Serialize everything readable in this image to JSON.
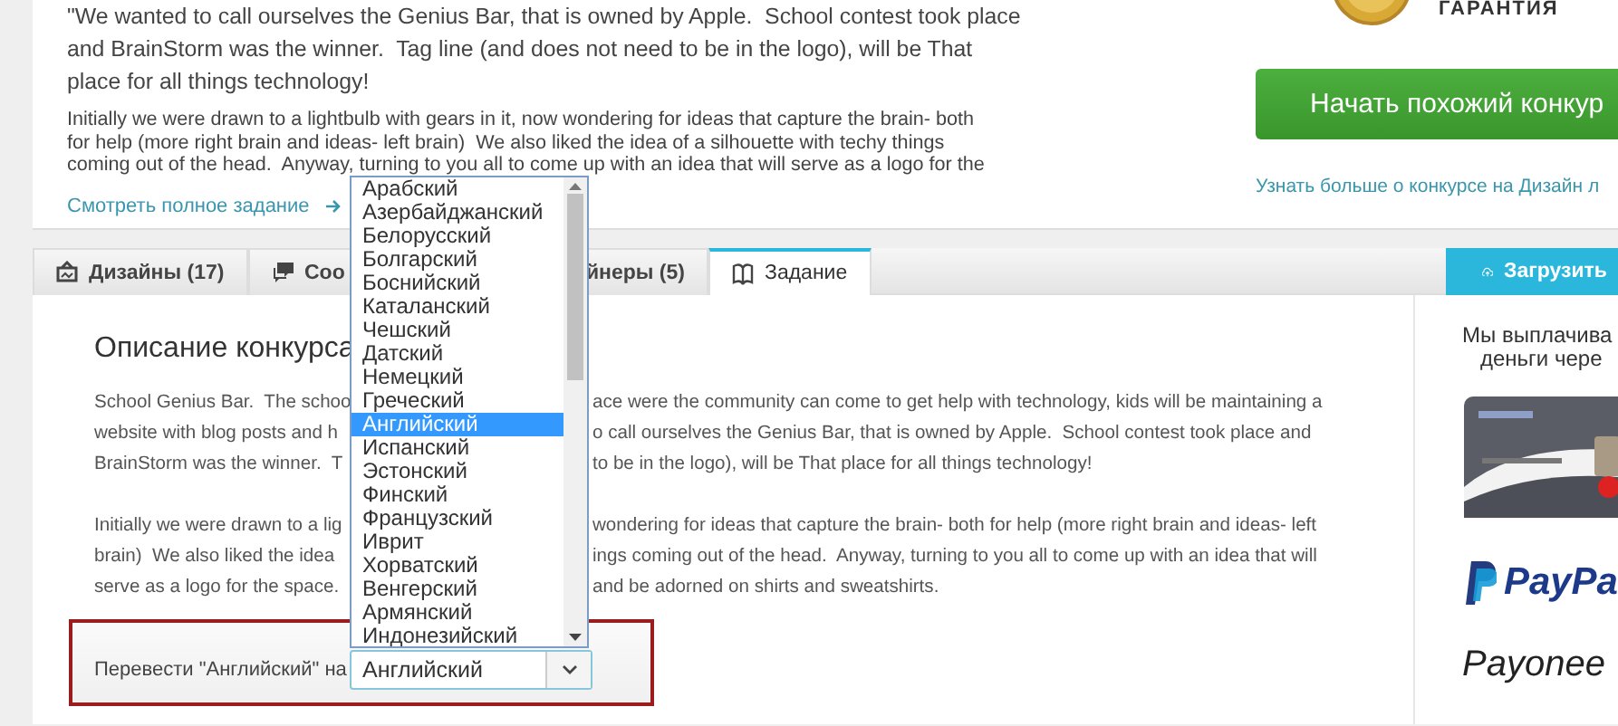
{
  "brief_card": {
    "lines_top": [
      "\"We wanted to call ourselves the Genius Bar, that is owned by Apple.  School contest took place",
      "and BrainStorm was the winner.  Tag line (and does not need to be in the logo), will be That",
      "place for all things technology!"
    ],
    "lines_small": [
      "Initially we were drawn to a lightbulb with gears in it, now wondering for ideas that capture the brain- both",
      "for help (more right brain and ideas- left brain)  We also liked the idea of a silhouette with techy things",
      "coming out of the head.  Anyway, turning to you all to come up with an idea that will serve as a logo for the"
    ],
    "link": "Смотреть полное задание",
    "guarantee": "ГАРАНТИЯ",
    "start_button": "Начать похожий конкур",
    "learn_more": "Узнать больше о конкурсе на Дизайн л"
  },
  "tabs": [
    {
      "label": "Дизайны (17)",
      "selected": false
    },
    {
      "label": "Соо",
      "selected": false
    },
    {
      "label": "йнеры (5)",
      "selected": false
    },
    {
      "label": "Задание",
      "selected": true
    }
  ],
  "upload_button": "Загрузить",
  "description": {
    "title": "Описание конкурса",
    "paragraphs": [
      [
        {
          "left": "School Genius Bar.  The schoo",
          "right": "ace were the community can come to get help with technology, kids will be maintaining a"
        },
        {
          "left": "website with blog posts and h",
          "right": "o call ourselves the Genius Bar, that is owned by Apple.  School contest took place and"
        },
        {
          "left": "BrainStorm was the winner.  T",
          "right": "to be in the logo), will be That place for all things technology!"
        }
      ],
      [
        {
          "left": "Initially we were drawn to a lig",
          "right": "wondering for ideas that capture the brain- both for help (more right brain and ideas- left"
        },
        {
          "left": "brain)  We also liked the idea",
          "right": "ings coming out of the head.  Anyway, turning to you all to come up with an idea that will"
        },
        {
          "left": "serve as a logo for the space.",
          "right": "and be adorned on shirts and sweatshirts."
        }
      ]
    ]
  },
  "translate": {
    "label": "Перевести \"Английский\" на",
    "value": "Английский",
    "options": [
      {
        "label": "Арабский",
        "selected": false
      },
      {
        "label": "Азербайджанский",
        "selected": false
      },
      {
        "label": "Белорусский",
        "selected": false
      },
      {
        "label": "Болгарский",
        "selected": false
      },
      {
        "label": "Боснийский",
        "selected": false
      },
      {
        "label": "Каталанский",
        "selected": false
      },
      {
        "label": "Чешский",
        "selected": false
      },
      {
        "label": "Датский",
        "selected": false
      },
      {
        "label": "Немецкий",
        "selected": false
      },
      {
        "label": "Греческий",
        "selected": false
      },
      {
        "label": "Английский",
        "selected": true
      },
      {
        "label": "Испанский",
        "selected": false
      },
      {
        "label": "Эстонский",
        "selected": false
      },
      {
        "label": "Финский",
        "selected": false
      },
      {
        "label": "Французский",
        "selected": false
      },
      {
        "label": "Иврит",
        "selected": false
      },
      {
        "label": "Хорватский",
        "selected": false
      },
      {
        "label": "Венгерский",
        "selected": false
      },
      {
        "label": "Армянский",
        "selected": false
      },
      {
        "label": "Индонезийский",
        "selected": false
      }
    ]
  },
  "sidebar": {
    "payout_lines": [
      "Мы выплачива",
      "деньги чере"
    ],
    "card": {
      "kind": "picture"
    },
    "logos": [
      {
        "kind": "paypal",
        "text": "PayPa"
      },
      {
        "kind": "payoneer",
        "text": "Payonee"
      }
    ]
  }
}
